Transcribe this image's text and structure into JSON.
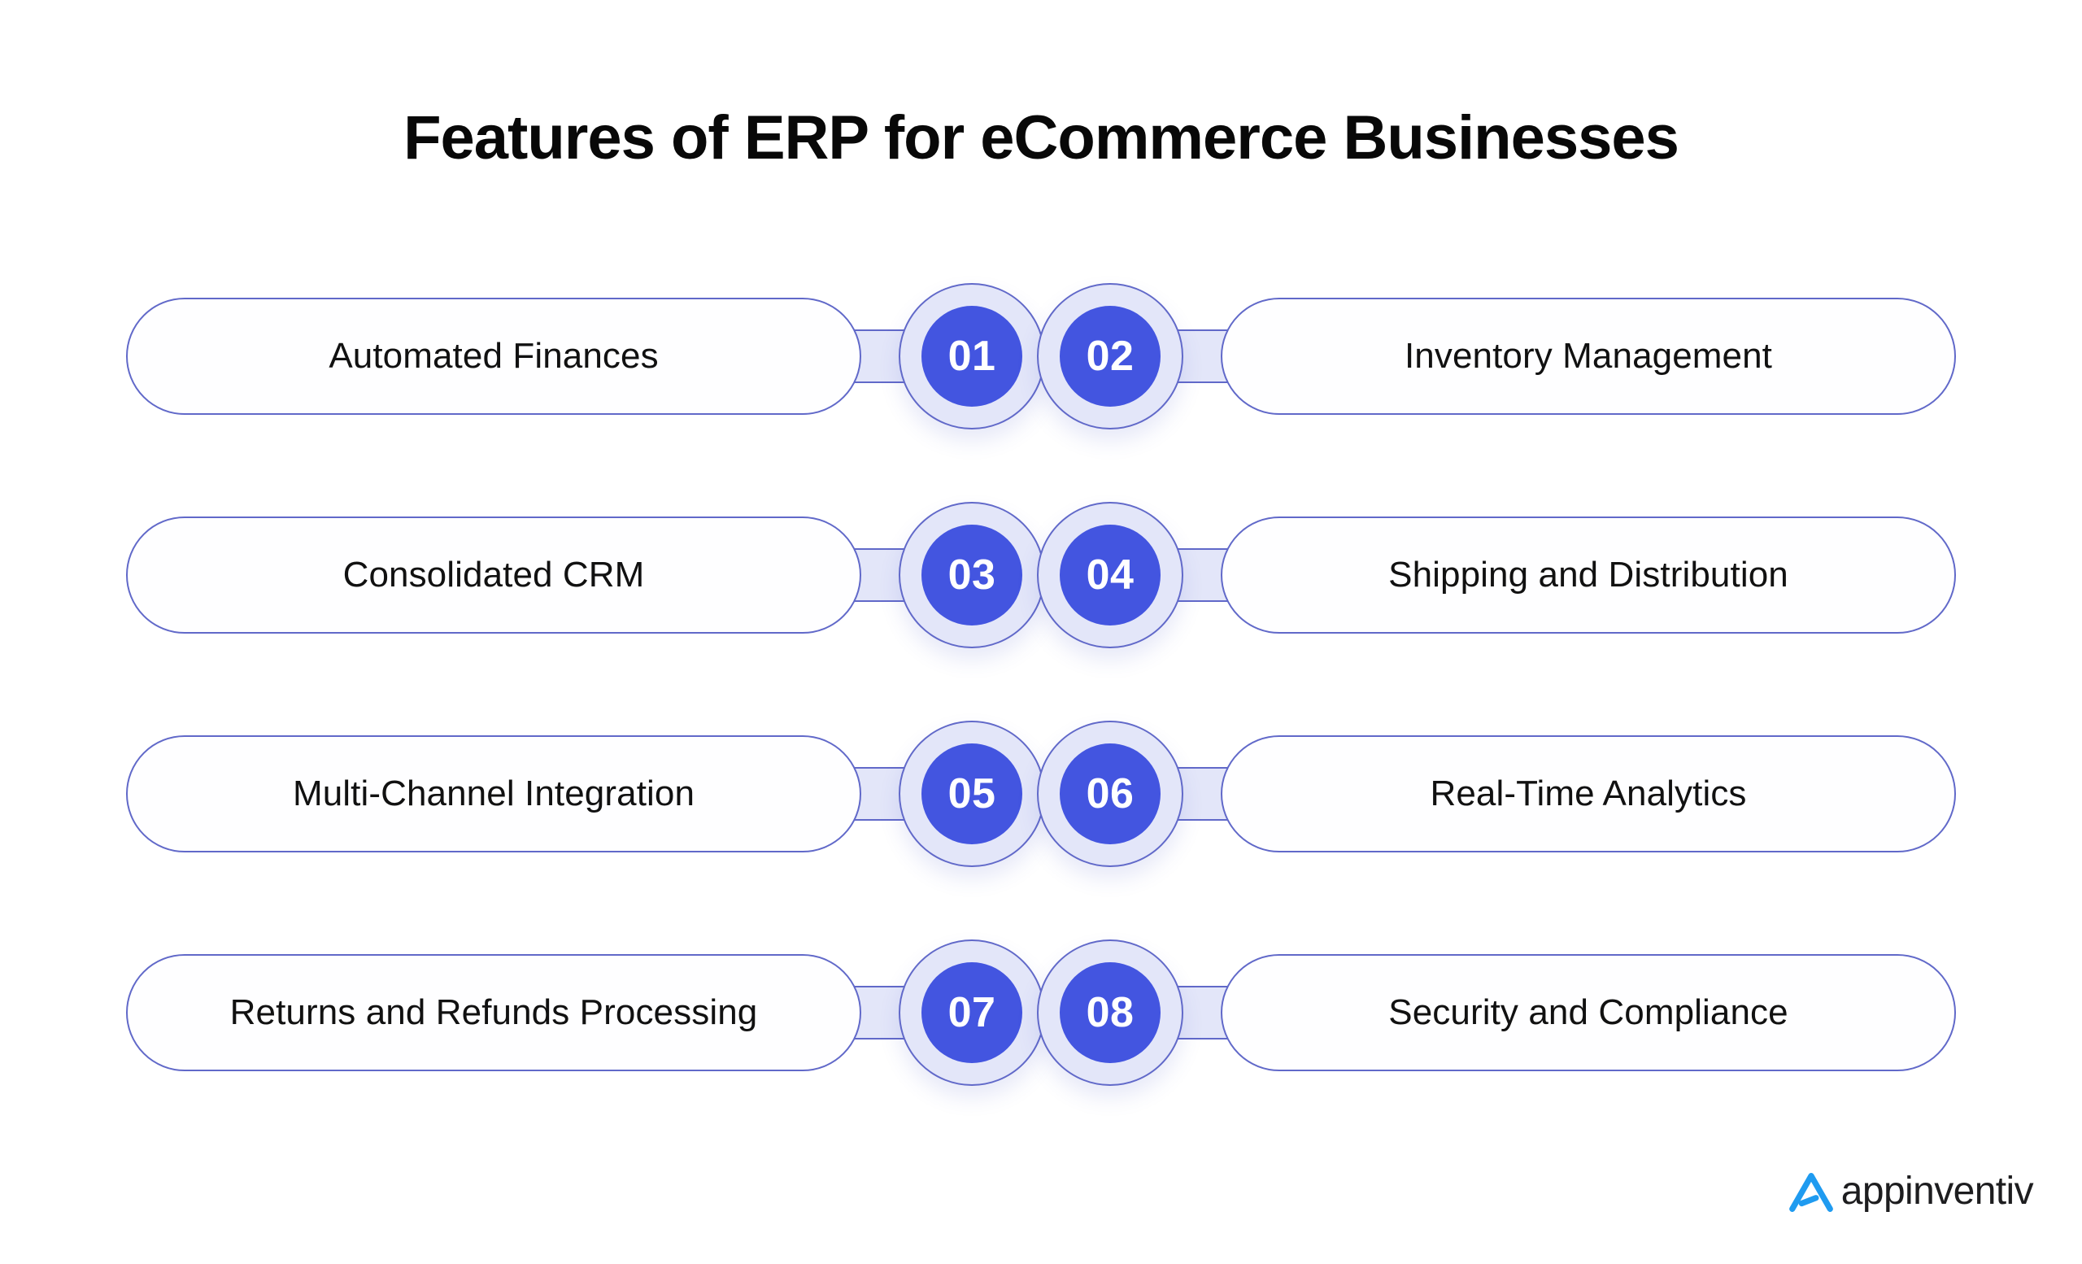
{
  "page": {
    "title": "Features of ERP for eCommerce Businesses",
    "background_color": "#ffffff"
  },
  "colors": {
    "accent_blue": "#4355e0",
    "ring_lavender": "#e3e6f9",
    "outline_blue": "#6169c9",
    "title_text": "#080808",
    "label_text": "#111111",
    "badge_number_text": "#ffffff",
    "logo_mark_blue": "#1f9bf0",
    "logo_text": "#1d1d1f"
  },
  "rows": [
    {
      "left": {
        "number": "01",
        "label": "Automated Finances"
      },
      "right": {
        "number": "02",
        "label": "Inventory Management"
      }
    },
    {
      "left": {
        "number": "03",
        "label": "Consolidated CRM"
      },
      "right": {
        "number": "04",
        "label": "Shipping and Distribution"
      }
    },
    {
      "left": {
        "number": "05",
        "label": "Multi-Channel Integration"
      },
      "right": {
        "number": "06",
        "label": "Real-Time Analytics"
      }
    },
    {
      "left": {
        "number": "07",
        "label": "Returns and Refunds Processing"
      },
      "right": {
        "number": "08",
        "label": "Security and Compliance"
      }
    }
  ],
  "logo": {
    "mark_name": "appinventiv-a-mark-icon",
    "text": "appinventiv"
  }
}
